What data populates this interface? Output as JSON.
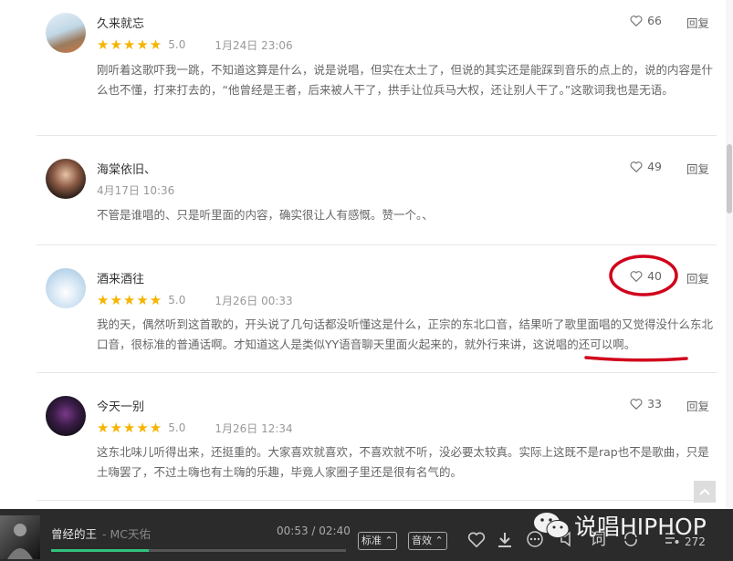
{
  "comments": [
    {
      "user": "久来就忘",
      "rating_stars": "★★★★★",
      "score": "5.0",
      "time": "1月24日 23:06",
      "likes": "66",
      "reply": "回复",
      "text": "刚听着这歌吓我一跳，不知道这算是什么，说是说唱，但实在太土了，但说的其实还是能踩到音乐的点上的，说的内容是什么也不懂，打来打去的，“他曾经是王者，后来被人干了，拱手让位兵马大权，还让别人干了。”这歌词我也是无语。"
    },
    {
      "user": "海棠依旧、",
      "time": "4月17日 10:36",
      "likes": "49",
      "reply": "回复",
      "text": "不管是谁唱的、只是听里面的内容，确实很让人有感慨。赞一个。、"
    },
    {
      "user": "酒来酒往",
      "rating_stars": "★★★★★",
      "score": "5.0",
      "time": "1月26日 00:33",
      "likes": "40",
      "reply": "回复",
      "text": "我的天，偶然听到这首歌的，开头说了几句话都没听懂这是什么，正宗的东北口音，结果听了歌里面唱的又觉得没什么东北口音，很标准的普通话啊。才知道这人是类似YY语音聊天里面火起来的，就外行来讲，这说唱的还可以啊。"
    },
    {
      "user": "今天一别",
      "rating_stars": "★★★★★",
      "score": "5.0",
      "time": "1月26日 12:34",
      "likes": "33",
      "reply": "回复",
      "text": "这东北味儿听得出来，还挺重的。大家喜欢就喜欢，不喜欢就不听，没必要太较真。实际上这既不是rap也不是歌曲，只是土嗨罢了，不过土嗨也有土嗨的乐趣，毕竟人家圈子里还是很有名气的。"
    }
  ],
  "player": {
    "song_title": "曾经的王",
    "artist": " - MC天佑",
    "current_time": "00:53",
    "total_time": "02:40",
    "progress": 0.33,
    "quality_button": "标准",
    "effect_button": "音效",
    "lyrics_label": "词",
    "playlist_count": "272"
  },
  "watermark": {
    "text": "说唱HIPHOP"
  },
  "colors": {
    "accent": "#31c27c",
    "star": "#f5b400",
    "annotation": "#d0021b"
  }
}
